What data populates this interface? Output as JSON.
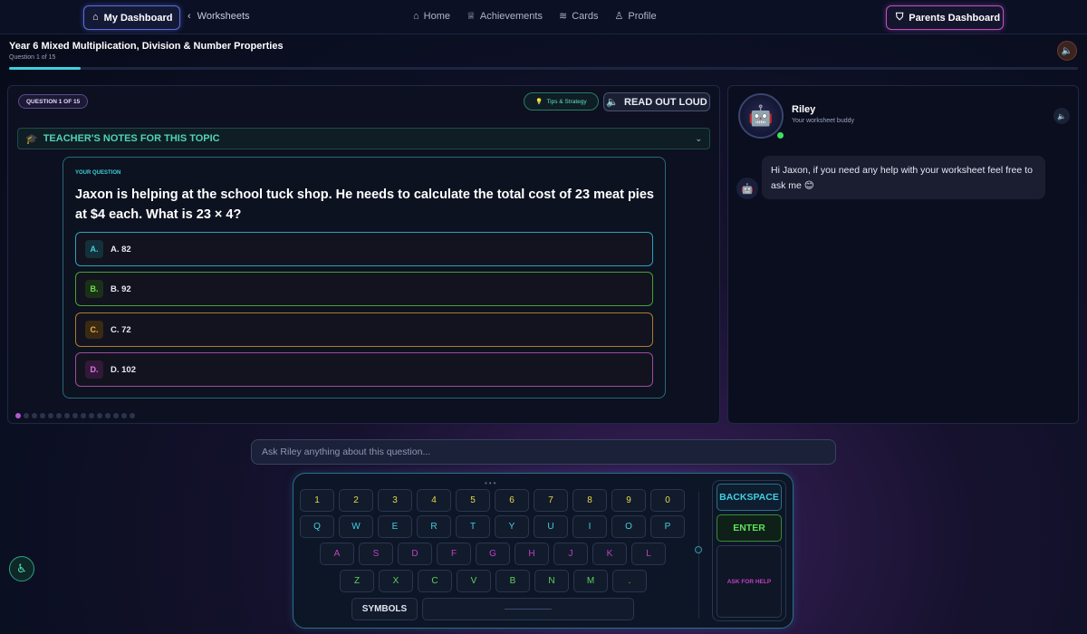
{
  "nav": {
    "dashboard_label": "My Dashboard",
    "back_label": "Worksheets",
    "home_label": "Home",
    "achievements_label": "Achievements",
    "cards_label": "Cards",
    "profile_label": "Profile",
    "parents_label": "Parents Dashboard"
  },
  "worksheet": {
    "title": "Year 6 Mixed Multiplication, Division & Number Properties",
    "progress_text": "Question 1 of 15",
    "progress_fraction": 0.0667
  },
  "question_panel": {
    "badge": "QUESTION 1 OF 15",
    "tips_label": "Tips & Strategy",
    "read_out_label": "READ OUT LOUD",
    "teacher_notes_label": "TEACHER'S NOTES FOR THIS TOPIC",
    "your_question_label": "YOUR QUESTION",
    "question_text": "Jaxon is helping at the school tuck shop. He needs to calculate the total cost of 23 meat pies at $4 each. What is 23 × 4?",
    "options": [
      {
        "letter": "A.",
        "text": "A. 82"
      },
      {
        "letter": "B.",
        "text": "B. 92"
      },
      {
        "letter": "C.",
        "text": "C. 72"
      },
      {
        "letter": "D.",
        "text": "D. 102"
      }
    ],
    "total_questions": 15,
    "current_question": 1
  },
  "buddy": {
    "name": "Riley",
    "subtitle": "Your worksheet buddy",
    "message": "Hi Jaxon, if you need any help with your worksheet feel free to ask me 😊"
  },
  "ask": {
    "placeholder": "Ask Riley anything about this question..."
  },
  "keyboard": {
    "row_numbers": [
      "1",
      "2",
      "3",
      "4",
      "5",
      "6",
      "7",
      "8",
      "9",
      "0"
    ],
    "row_q": [
      "Q",
      "W",
      "E",
      "R",
      "T",
      "Y",
      "U",
      "I",
      "O",
      "P"
    ],
    "row_a": [
      "A",
      "S",
      "D",
      "F",
      "G",
      "H",
      "J",
      "K",
      "L"
    ],
    "row_z": [
      "Z",
      "X",
      "C",
      "V",
      "B",
      "N",
      "M",
      "."
    ],
    "symbols_label": "SYMBOLS",
    "backspace_label": "BACKSPACE",
    "enter_label": "ENTER",
    "help_label": "ASK FOR HELP"
  },
  "colors": {
    "accent_cyan": "#3fd0e0",
    "accent_green": "#5ee05a",
    "accent_amber": "#f0b040",
    "accent_magenta": "#c040c0"
  }
}
